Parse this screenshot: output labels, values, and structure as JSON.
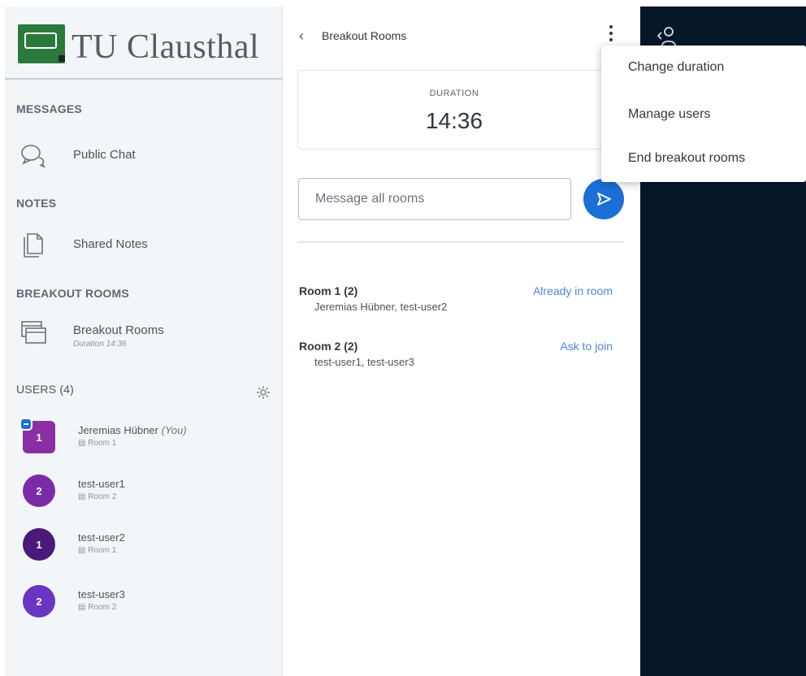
{
  "logo": {
    "text": "TU Clausthal"
  },
  "sidebar": {
    "messages_title": "MESSAGES",
    "public_chat_label": "Public Chat",
    "notes_title": "NOTES",
    "shared_notes_label": "Shared Notes",
    "breakout_title": "BREAKOUT ROOMS",
    "breakout_label": "Breakout Rooms",
    "breakout_sub": "Duration 14:36",
    "users_title": "USERS (4)",
    "users": [
      {
        "initial": "1",
        "name": "Jeremias Hübner",
        "you": "(You)",
        "room": "Room 1",
        "color": "#8a2fa3",
        "presenter": true
      },
      {
        "initial": "2",
        "name": "test-user1",
        "room": "Room 2",
        "color": "#7b2ba8"
      },
      {
        "initial": "1",
        "name": "test-user2",
        "room": "Room 1",
        "color": "#4a1a7a"
      },
      {
        "initial": "2",
        "name": "test-user3",
        "room": "Room 2",
        "color": "#6a35c2"
      }
    ]
  },
  "panel": {
    "title": "Breakout Rooms",
    "duration_label": "DURATION",
    "duration_time": "14:36",
    "message_placeholder": "Message all rooms",
    "rooms": [
      {
        "name": "Room 1 (2)",
        "users": "Jeremias Hübner, test-user2",
        "action": "Already in room"
      },
      {
        "name": "Room 2 (2)",
        "users": "test-user1, test-user3",
        "action": "Ask to join"
      }
    ]
  },
  "menu": {
    "items": [
      "Change duration",
      "Manage users",
      "End breakout rooms"
    ]
  },
  "colors": {
    "accent": "#1b6fd6",
    "dark_bg": "#06172a",
    "link": "#4e86d6"
  }
}
